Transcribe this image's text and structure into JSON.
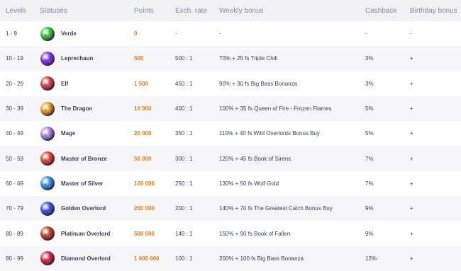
{
  "header": {
    "levels": "Levels",
    "statuses": "Statuses",
    "points": "Points",
    "rate": "Exch. rate",
    "bonus": "Weekly bonus",
    "cashback": "Cashback",
    "birthday": "Birthday bonus"
  },
  "rows": [
    {
      "level": "1 - 9",
      "status": "Verde",
      "points": "0",
      "rate": "-",
      "bonus": "-",
      "cashback": "-",
      "birthday": "-",
      "icon": "green-planet-icon",
      "color": "#3fcf3a"
    },
    {
      "level": "10 - 19",
      "status": "Leprechaun",
      "points": "500",
      "rate": "500 : 1",
      "bonus": "70% + 25 fs Triple Chili",
      "cashback": "3%",
      "birthday": "+",
      "icon": "purple-planet-icon",
      "color": "#8a3cf0"
    },
    {
      "level": "20 - 29",
      "status": "Elf",
      "points": "1 500",
      "rate": "450 : 1",
      "bonus": "90% + 30 fs Big Bass Bonanza",
      "cashback": "3%",
      "birthday": "+",
      "icon": "red-planet-icon",
      "color": "#e04a4a"
    },
    {
      "level": "30 - 39",
      "status": "The Dragon",
      "points": "10 000",
      "rate": "400 : 1",
      "bonus": "100% + 35 fs Queen of Fire - Frozen Flames",
      "cashback": "5%",
      "birthday": "+",
      "icon": "orange-planet-icon",
      "color": "#f5a623"
    },
    {
      "level": "40 - 49",
      "status": "Mage",
      "points": "20 000",
      "rate": "350 : 1",
      "bonus": "110% + 40 fs Wild Overlords Bonus Buy",
      "cashback": "5%",
      "birthday": "+",
      "icon": "violet-planet-icon",
      "color": "#b48ee6"
    },
    {
      "level": "50 - 59",
      "status": "Master of Bronze",
      "points": "50 000",
      "rate": "300 : 1",
      "bonus": "120% + 45 fs Book of Sirens",
      "cashback": "7%",
      "birthday": "+",
      "icon": "bronze-planet-icon",
      "color": "#e8503a"
    },
    {
      "level": "60 - 69",
      "status": "Master of Silver",
      "points": "100 000",
      "rate": "250 : 1",
      "bonus": "130% + 50 fs Wolf Gold",
      "cashback": "7%",
      "birthday": "+",
      "icon": "blue-planet-icon",
      "color": "#3aa0e8"
    },
    {
      "level": "70 - 79",
      "status": "Golden Overlord",
      "points": "200 000",
      "rate": "200 : 1",
      "bonus": "140% + 70 fs The Greatest Catch Bonus Buy",
      "cashback": "9%",
      "birthday": "+",
      "icon": "cobalt-planet-icon",
      "color": "#3b5de0"
    },
    {
      "level": "80 - 89",
      "status": "Platinum Overlord",
      "points": "500 000",
      "rate": "149 : 1",
      "bonus": "150% + 90 fs Book of Fallen",
      "cashback": "9%",
      "birthday": "+",
      "icon": "rust-planet-icon",
      "color": "#c8502e"
    },
    {
      "level": "90 - 99",
      "status": "Diamond Overlord",
      "points": "1 000 000",
      "rate": "100 : 1",
      "bonus": "200% + 100 fs Big Bass Bonanza",
      "cashback": "12%",
      "birthday": "+",
      "icon": "crimson-planet-icon",
      "color": "#d8324a"
    }
  ]
}
